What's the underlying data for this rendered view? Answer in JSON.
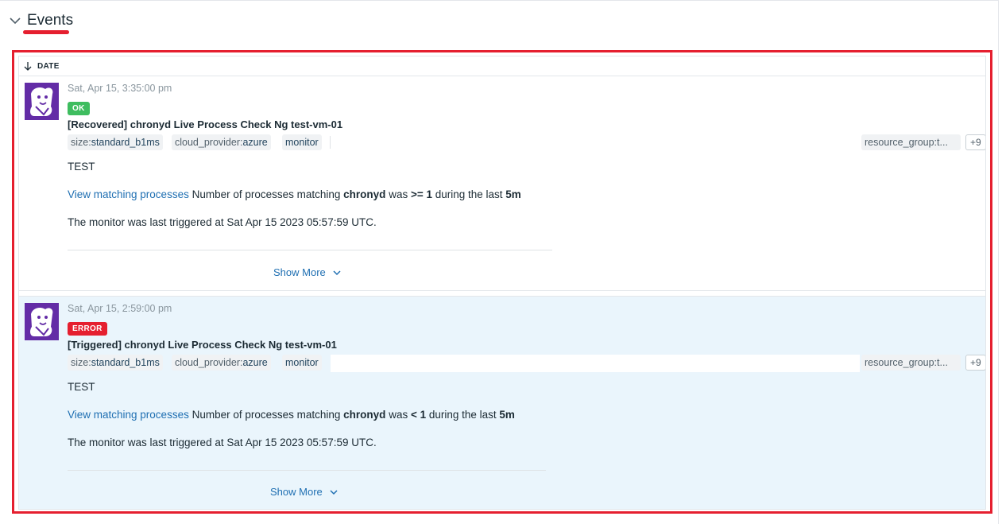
{
  "section": {
    "title": "Events"
  },
  "table": {
    "date_column": "DATE"
  },
  "events": [
    {
      "timestamp": "Sat, Apr 15, 3:35:00 pm",
      "status": "OK",
      "title": "[Recovered] chronyd Live Process Check Ng test-vm-01",
      "tags": [
        {
          "key": "size:",
          "value": "standard_b1ms"
        },
        {
          "key": "cloud_provider:",
          "value": "azure"
        },
        {
          "key": "",
          "value": "monitor"
        }
      ],
      "tag_right": "resource_group:t...",
      "tag_more": "+9",
      "test_line": "TEST",
      "processes": {
        "link": "View matching processes",
        "prefix": " Number of processes matching ",
        "process": "chronyd",
        "mid": " was ",
        "condition": ">= 1",
        "suffix": " during the last ",
        "window": "5m"
      },
      "trigger_line": "The monitor was last triggered at Sat Apr 15 2023 05:57:59 UTC.",
      "show_more": "Show More"
    },
    {
      "timestamp": "Sat, Apr 15, 2:59:00 pm",
      "status": "ERROR",
      "title": "[Triggered] chronyd Live Process Check Ng test-vm-01",
      "tags": [
        {
          "key": "size:",
          "value": "standard_b1ms"
        },
        {
          "key": "cloud_provider:",
          "value": "azure"
        },
        {
          "key": "",
          "value": "monitor"
        }
      ],
      "tag_right": "resource_group:t...",
      "tag_more": "+9",
      "test_line": "TEST",
      "processes": {
        "link": "View matching processes",
        "prefix": " Number of processes matching ",
        "process": "chronyd",
        "mid": " was ",
        "condition": "< 1",
        "suffix": " during the last ",
        "window": "5m"
      },
      "trigger_line": "The monitor was last triggered at Sat Apr 15 2023 05:57:59 UTC.",
      "show_more": "Show More"
    }
  ],
  "colors": {
    "accent": "#1f6fb2",
    "ok": "#3ebd5f",
    "error": "#e51f2f",
    "highlight_bg": "#eaf5fc",
    "avatar": "#632ca6"
  },
  "icons": {
    "collapse": "chevron-down-icon",
    "sort": "arrow-down-icon",
    "avatar": "datadog-logo-icon",
    "expand": "chevron-down-icon"
  }
}
